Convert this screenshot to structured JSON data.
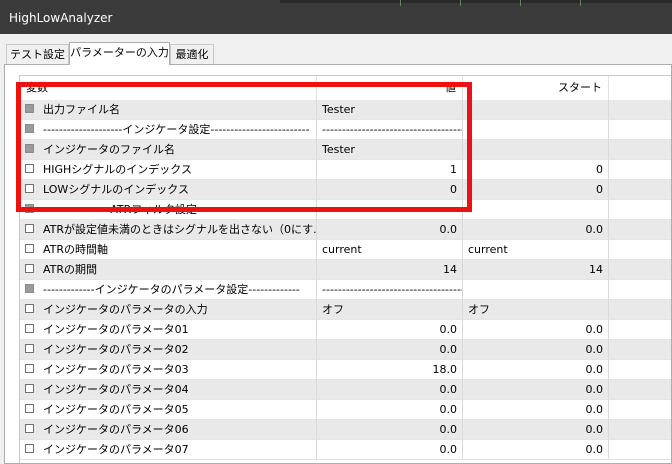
{
  "window": {
    "title": "HighLowAnalyzer"
  },
  "tabs": [
    {
      "label": "テスト設定"
    },
    {
      "label": "パラメーターの入力",
      "active": true
    },
    {
      "label": "最適化"
    }
  ],
  "table": {
    "columns": {
      "variable": "変数",
      "value": "値",
      "start": "スタート"
    },
    "rows": [
      {
        "name": "出力ファイル名",
        "value": "Tester",
        "start": "",
        "checkbox": "disabled"
      },
      {
        "name": "--------------------インジケータ設定-------------------------",
        "value": "----------------------------------------------------------------------------------------------------",
        "start": "",
        "checkbox": "disabled"
      },
      {
        "name": "インジケータのファイル名",
        "value": "Tester",
        "start": "",
        "checkbox": "disabled"
      },
      {
        "name": "HIGHシグナルのインデックス",
        "value": "1",
        "start": "0",
        "checkbox": "enabled",
        "numeric": true
      },
      {
        "name": "LOWシグナルのインデックス",
        "value": "0",
        "start": "0",
        "checkbox": "enabled",
        "numeric": true
      },
      {
        "name": "-----------------ATRフィルタ設定--------------------",
        "value": "----------------------------------------------------------------------------------------------------",
        "start": "",
        "checkbox": "disabled"
      },
      {
        "name": "ATRが設定値未満のときはシグナルを出さない（0にす...",
        "value": "0.0",
        "start": "0.0",
        "checkbox": "enabled",
        "numeric": true
      },
      {
        "name": "ATRの時間軸",
        "value": "current",
        "start": "current",
        "checkbox": "enabled"
      },
      {
        "name": "ATRの期間",
        "value": "14",
        "start": "14",
        "checkbox": "enabled",
        "numeric": true
      },
      {
        "name": "-------------インジケータのパラメータ設定-------------",
        "value": "----------------------------------------------------------------------------------------------------",
        "start": "",
        "checkbox": "disabled"
      },
      {
        "name": "インジケータのパラメータの入力",
        "value": "オフ",
        "start": "オフ",
        "checkbox": "enabled"
      },
      {
        "name": "インジケータのパラメータ01",
        "value": "0.0",
        "start": "0.0",
        "checkbox": "enabled",
        "numeric": true
      },
      {
        "name": "インジケータのパラメータ02",
        "value": "0.0",
        "start": "0.0",
        "checkbox": "enabled",
        "numeric": true
      },
      {
        "name": "インジケータのパラメータ03",
        "value": "18.0",
        "start": "0.0",
        "checkbox": "enabled",
        "numeric": true
      },
      {
        "name": "インジケータのパラメータ04",
        "value": "0.0",
        "start": "0.0",
        "checkbox": "enabled",
        "numeric": true
      },
      {
        "name": "インジケータのパラメータ05",
        "value": "0.0",
        "start": "0.0",
        "checkbox": "enabled",
        "numeric": true
      },
      {
        "name": "インジケータのパラメータ06",
        "value": "0.0",
        "start": "0.0",
        "checkbox": "enabled",
        "numeric": true
      },
      {
        "name": "インジケータのパラメータ07",
        "value": "0.0",
        "start": "0.0",
        "checkbox": "enabled",
        "numeric": true
      }
    ]
  },
  "highlight": {
    "color": "#ee1111"
  }
}
